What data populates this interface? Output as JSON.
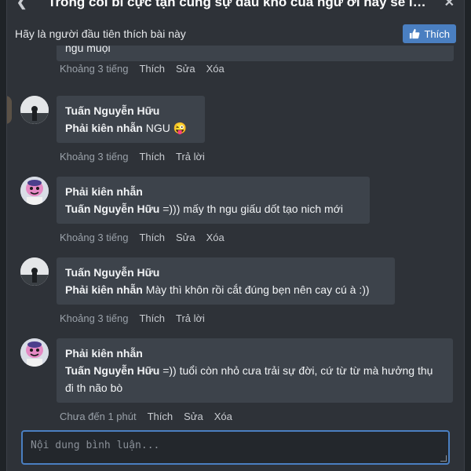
{
  "header": {
    "title": "Trong cõi bi cực tận cùng sự đau khổ của ngư ơi hãy sẽ là ...",
    "back_icon": "chevron-left-icon",
    "close_icon": "close-icon"
  },
  "like_bar": {
    "text": "Hãy là người đầu tiên thích bài này",
    "button_label": "Thích",
    "button_color": "#4a7fc1"
  },
  "comments": [
    {
      "type": "partial",
      "text": "ngu muội",
      "time": "Khoảng 3 tiếng",
      "actions": [
        "Thích",
        "Sửa",
        "Xóa"
      ]
    },
    {
      "author": "Tuấn Nguyễn Hữu",
      "avatar": "photo-avatar",
      "mention": "Phải kiên nhẫn",
      "text": " NGU 😜",
      "time": "Khoảng 3 tiếng",
      "actions": [
        "Thích",
        "Trả lời"
      ]
    },
    {
      "author": "Phải kiên nhẫn",
      "avatar": "cartoon-avatar",
      "mention": "Tuấn Nguyễn Hữu",
      "text": " =))) mấy th ngu giấu dốt tạo nich mới",
      "time": "Khoảng 3 tiếng",
      "actions": [
        "Thích",
        "Sửa",
        "Xóa"
      ]
    },
    {
      "author": "Tuấn Nguyễn Hữu",
      "avatar": "photo-avatar",
      "mention": "Phải kiên nhẫn",
      "text": " Mày thì khôn rồi cắt đúng bẹn nên cay cú à :))",
      "time": "Khoảng 3 tiếng",
      "actions": [
        "Thích",
        "Trả lời"
      ]
    },
    {
      "author": "Phải kiên nhẫn",
      "avatar": "cartoon-avatar",
      "mention": "Tuấn Nguyễn Hữu",
      "text": " =)) tuổi còn nhỏ cưa trải sự đời, cứ từ từ mà hưởng thụ đi th não bò",
      "time": "Chưa đến 1 phút",
      "actions": [
        "Thích",
        "Sửa",
        "Xóa"
      ]
    }
  ],
  "composer": {
    "placeholder": "Nội dung bình luận..."
  }
}
